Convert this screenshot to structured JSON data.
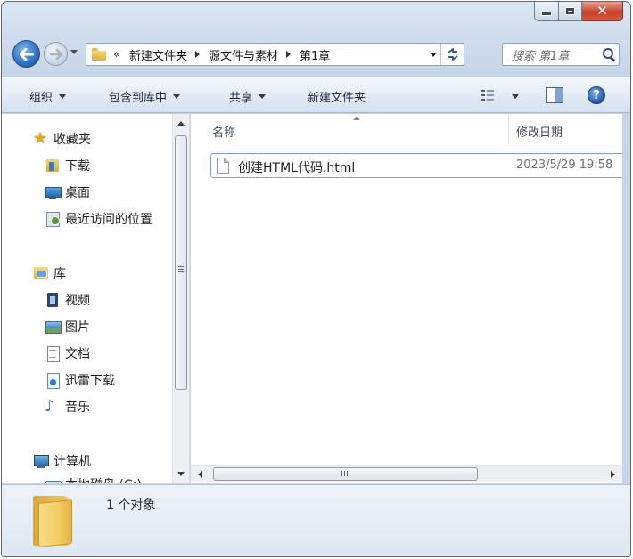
{
  "window": {
    "close_glyph": "✕"
  },
  "address_bar": {
    "overflow_chevron": "«",
    "crumbs": [
      "新建文件夹",
      "源文件与素材",
      "第1章"
    ]
  },
  "search": {
    "placeholder": "搜索 第1章"
  },
  "toolbar": {
    "organize": "组织",
    "include_in_library": "包含到库中",
    "share": "共享",
    "new_folder": "新建文件夹",
    "help_glyph": "?"
  },
  "nav_pane": {
    "favorites": "收藏夹",
    "downloads": "下载",
    "desktop": "桌面",
    "recent": "最近访问的位置",
    "libraries": "库",
    "videos": "视频",
    "pictures": "图片",
    "documents": "文档",
    "xunlei": "迅雷下载",
    "music": "音乐",
    "computer": "计算机",
    "local_disk": "本地磁盘 (C:)"
  },
  "content": {
    "columns": [
      "名称",
      "修改日期"
    ],
    "files": [
      {
        "name": "创建HTML代码.html",
        "modified": "2023/5/29 19:58"
      }
    ]
  },
  "details": {
    "status": "1 个对象"
  },
  "icons": {
    "back": "back-arrow-icon",
    "forward": "forward-arrow-icon",
    "refresh": "refresh-icon",
    "search": "search-icon",
    "views": "views-icon",
    "preview_pane": "preview-pane-icon",
    "help": "help-icon"
  }
}
